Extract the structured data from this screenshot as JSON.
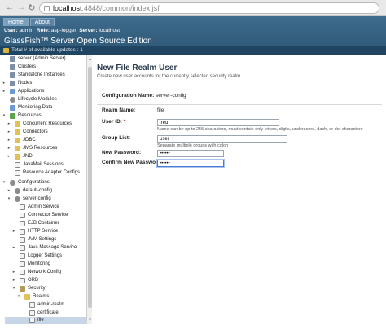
{
  "browser": {
    "url_host": "localhost",
    "url_path": ":4848/common/index.jsf"
  },
  "masthead": {
    "tabs": [
      {
        "label": "Home"
      },
      {
        "label": "About"
      }
    ],
    "user_label": "User:",
    "user_value": "admin",
    "role_label": "Role:",
    "role_value": "asp-logger",
    "server_label": "Server:",
    "server_value": "localhost",
    "product_name": "GlassFish™ Server Open Source Edition",
    "updates_text": "Total # of available updates : 1"
  },
  "tree": {
    "items": [
      {
        "label": "server (Admin Server)"
      },
      {
        "label": "Clusters"
      },
      {
        "label": "Standalone Instances"
      },
      {
        "label": "Nodes"
      },
      {
        "label": "Applications"
      },
      {
        "label": "Lifecycle Modules"
      },
      {
        "label": "Monitoring Data"
      },
      {
        "label": "Resources"
      },
      {
        "label": "Concurrent Resources"
      },
      {
        "label": "Connectors"
      },
      {
        "label": "JDBC"
      },
      {
        "label": "JMS Resources"
      },
      {
        "label": "JNDI"
      },
      {
        "label": "JavaMail Sessions"
      },
      {
        "label": "Resource Adapter Configs"
      },
      {
        "label": "Configurations"
      },
      {
        "label": "default-config"
      },
      {
        "label": "server-config"
      },
      {
        "label": "Admin Service"
      },
      {
        "label": "Connector Service"
      },
      {
        "label": "EJB Container"
      },
      {
        "label": "HTTP Service"
      },
      {
        "label": "JVM Settings"
      },
      {
        "label": "Java Message Service"
      },
      {
        "label": "Logger Settings"
      },
      {
        "label": "Monitoring"
      },
      {
        "label": "Network Config"
      },
      {
        "label": "ORB"
      },
      {
        "label": "Security"
      },
      {
        "label": "Realms"
      },
      {
        "label": "admin-realm"
      },
      {
        "label": "certificate"
      },
      {
        "label": "file"
      }
    ]
  },
  "page": {
    "title": "New File Realm User",
    "help": "Create new user accounts for the currently selected security realm.",
    "config_label": "Configuration Name:",
    "config_value": "server-config",
    "realm_label": "Realm Name:",
    "realm_value": "file",
    "userid_label": "User ID:",
    "userid_required": "*",
    "userid_value": "fred",
    "userid_hint": "Name can be up to 255 characters, must contain only letters, digits, underscore, dash, or dot characters",
    "group_label": "Group List:",
    "group_value": "user",
    "group_hint": "Separate multiple groups with colon",
    "password_label": "New Password:",
    "password_value": "••••••",
    "confirm_label": "Confirm New Password:",
    "confirm_value": "••••••"
  }
}
